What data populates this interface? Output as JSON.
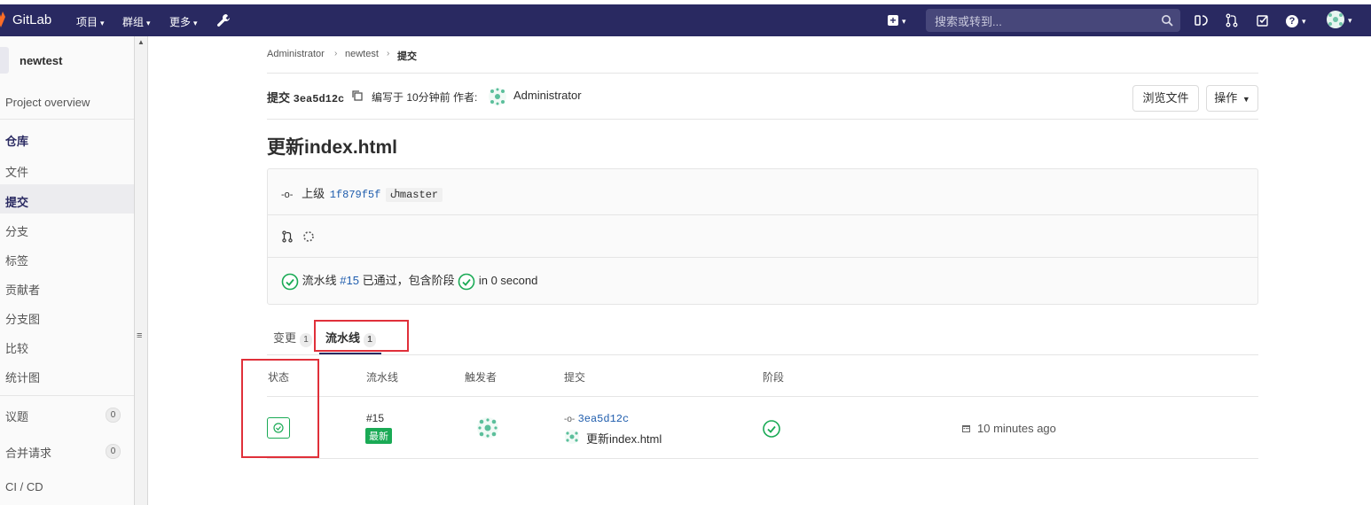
{
  "nav": {
    "brand": "GitLab",
    "menus": [
      "项目",
      "群组",
      "更多"
    ],
    "search_placeholder": "搜索或转到..."
  },
  "sidebar": {
    "project_name": "newtest",
    "overview": "Project overview",
    "section": "仓库",
    "items": [
      "文件",
      "提交",
      "分支",
      "标签",
      "贡献者",
      "分支图",
      "比较",
      "统计图"
    ],
    "issues_label": "议题",
    "issues_count": "0",
    "mr_label": "合并请求",
    "mr_count": "0",
    "cicd": "CI / CD"
  },
  "breadcrumb": [
    "Administrator",
    "newtest",
    "提交"
  ],
  "commit": {
    "prefix": "提交",
    "sha": "3ea5d12c",
    "authored_text": "编写于 10分钟前 作者:",
    "author": "Administrator",
    "browse_button": "浏览文件",
    "actions_button": "操作",
    "title": "更新index.html",
    "parent_label": "上级",
    "parent_sha": "1f879f5f",
    "branch": "master",
    "pipeline_text_prefix": "流水线",
    "pipeline_id": "#15",
    "pipeline_text_suffix": "已通过，包含阶段",
    "duration": "in 0 second"
  },
  "tabs": [
    {
      "label": "变更",
      "count": "1"
    },
    {
      "label": "流水线",
      "count": "1"
    }
  ],
  "table": {
    "headers": [
      "状态",
      "流水线",
      "触发者",
      "提交",
      "阶段"
    ],
    "row": {
      "pipeline_id": "#15",
      "latest_badge": "最新",
      "commit_sha": "3ea5d12c",
      "commit_message": "更新index.html",
      "time": "10 minutes ago"
    }
  },
  "colors": {
    "nav_bg": "#292961",
    "success": "#1aaa55",
    "link": "#1f5dad",
    "highlight_box": "#e0303a"
  }
}
